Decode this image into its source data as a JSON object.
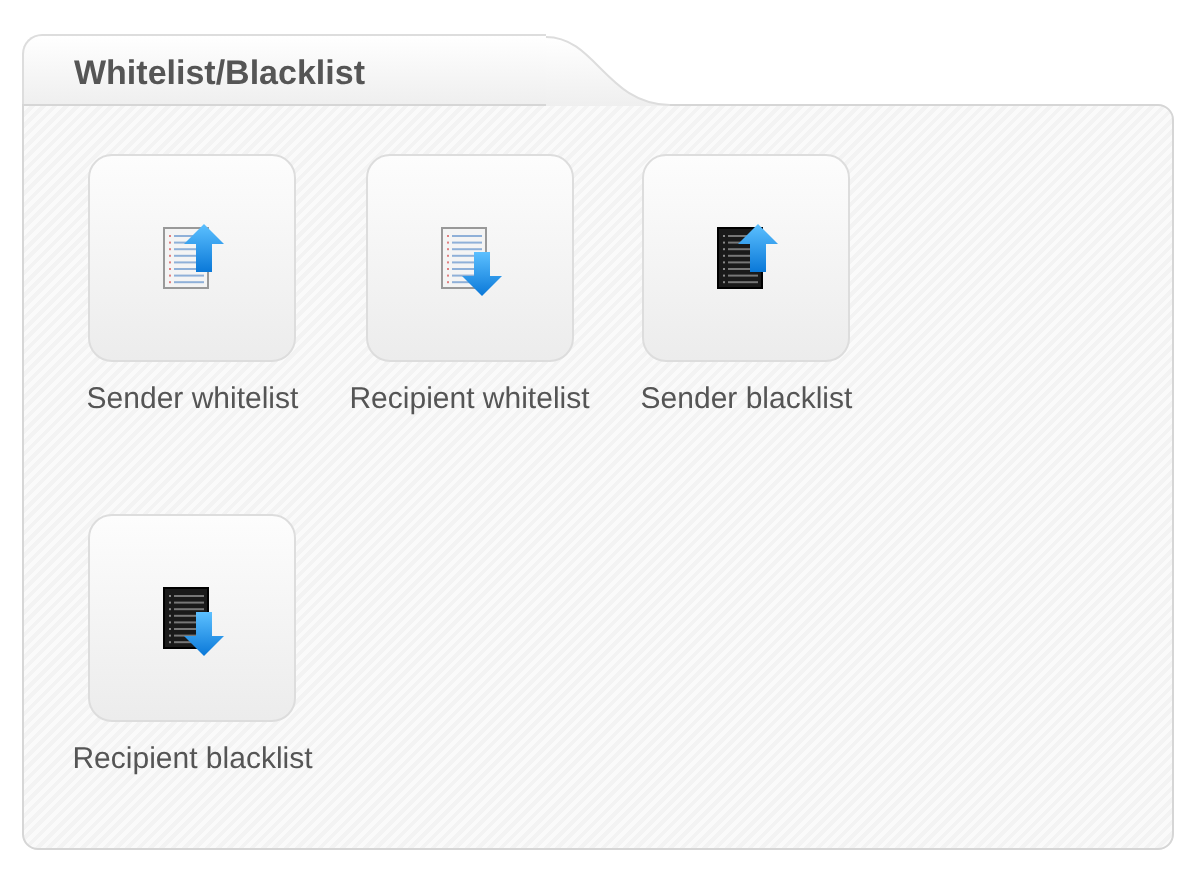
{
  "panel": {
    "title": "Whitelist/Blacklist"
  },
  "items": [
    {
      "label": "Sender whitelist",
      "kind": "lightup"
    },
    {
      "label": "Recipient whitelist",
      "kind": "lightdown"
    },
    {
      "label": "Sender blacklist",
      "kind": "darkup"
    },
    {
      "label": "Recipient blacklist",
      "kind": "darkdown"
    }
  ]
}
